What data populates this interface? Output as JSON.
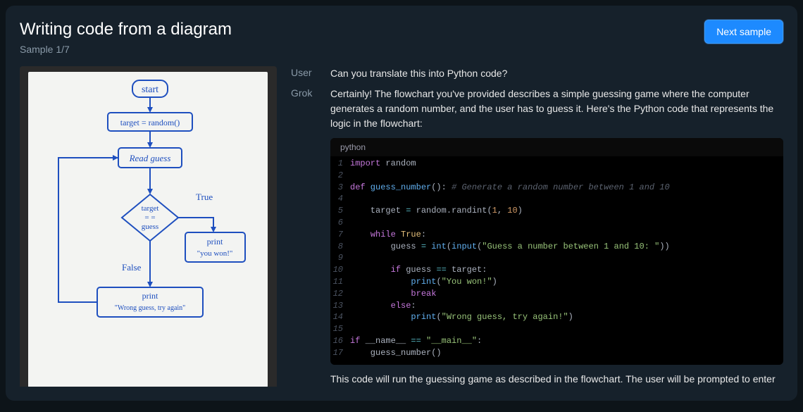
{
  "header": {
    "title": "Writing code from a diagram",
    "sample_counter": "Sample 1/7",
    "next_button": "Next sample"
  },
  "diagram": {
    "nodes": {
      "start": "start",
      "target": "target = random()",
      "read": "Read guess",
      "decision_l1": "target",
      "decision_l2": "= =",
      "decision_l3": "guess",
      "true_label": "True",
      "false_label": "False",
      "win_l1": "print",
      "win_l2": "\"you won!\"",
      "lose_l1": "print",
      "lose_l2": "\"Wrong guess, try again\""
    }
  },
  "chat": {
    "user_role": "User",
    "user_msg": "Can you translate this into Python code?",
    "grok_role": "Grok",
    "grok_intro": "Certainly! The flowchart you've provided describes a simple guessing game where the computer generates a random number, and the user has to guess it. Here's the Python code that represents the logic in the flowchart:",
    "code_lang": "python",
    "grok_outro": "This code will run the guessing game as described in the flowchart. The user will be prompted to enter their guess until they guess the correct number."
  },
  "code": {
    "l1": {
      "a": "import",
      "b": " random"
    },
    "l3": {
      "a": "def",
      "b": " guess_number",
      "c": "():",
      "d": " # Generate a random number between 1 and 10"
    },
    "l5": {
      "a": "    target ",
      "b": "=",
      "c": " random.randint(",
      "d": "1",
      "e": ", ",
      "f": "10",
      "g": ")"
    },
    "l7": {
      "a": "    ",
      "b": "while",
      "c": " ",
      "d": "True",
      "e": ":"
    },
    "l8": {
      "a": "        guess ",
      "b": "=",
      "c": " ",
      "d": "int",
      "e": "(",
      "f": "input",
      "g": "(",
      "h": "\"Guess a number between 1 and 10: \"",
      "i": "))"
    },
    "l10": {
      "a": "        ",
      "b": "if",
      "c": " guess ",
      "d": "==",
      "e": " target:"
    },
    "l11": {
      "a": "            ",
      "b": "print",
      "c": "(",
      "d": "\"You won!\"",
      "e": ")"
    },
    "l12": {
      "a": "            ",
      "b": "break"
    },
    "l13": {
      "a": "        ",
      "b": "else",
      "c": ":"
    },
    "l14": {
      "a": "            ",
      "b": "print",
      "c": "(",
      "d": "\"Wrong guess, try again!\"",
      "e": ")"
    },
    "l16": {
      "a": "if",
      "b": " __name__ ",
      "c": "==",
      "d": " ",
      "e": "\"__main__\"",
      "f": ":"
    },
    "l17": {
      "a": "    guess_number()"
    }
  }
}
